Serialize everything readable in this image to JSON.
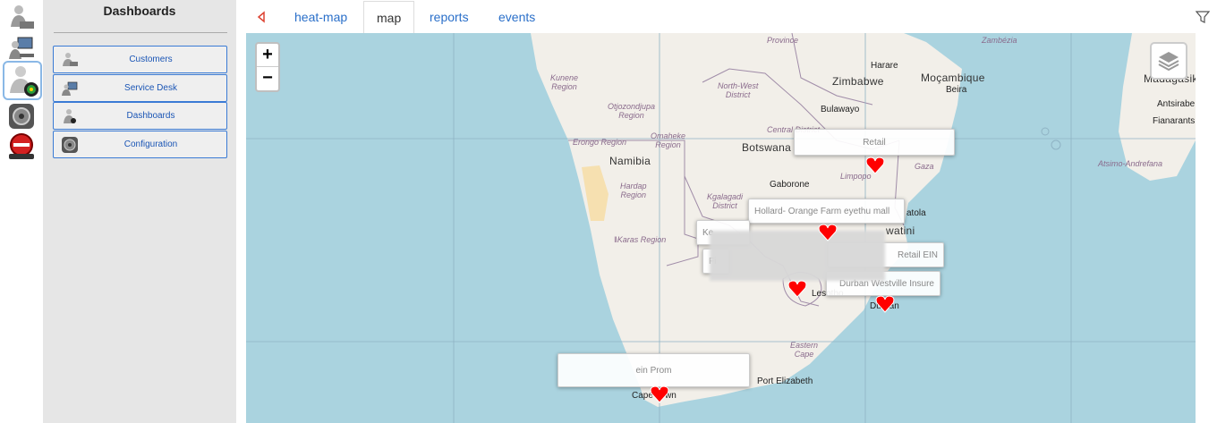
{
  "rail": {
    "items": [
      {
        "icon": "user-desk-icon"
      },
      {
        "icon": "service-desk-icon"
      },
      {
        "icon": "dashboards-icon",
        "selected": true
      },
      {
        "icon": "configuration-gear-icon"
      },
      {
        "icon": "logout-icon",
        "label": "LOGOUT"
      }
    ]
  },
  "panel": {
    "title": "Dashboards",
    "items": [
      {
        "label": "Customers",
        "icon": "customers-icon"
      },
      {
        "label": "Service Desk",
        "icon": "service-desk-icon"
      },
      {
        "label": "Dashboards",
        "icon": "dashboards-icon"
      },
      {
        "label": "Configuration",
        "icon": "configuration-icon"
      }
    ]
  },
  "tabs": {
    "items": [
      "heat-map",
      "map",
      "reports",
      "events"
    ],
    "active": "map"
  },
  "map": {
    "zoom_in": "+",
    "zoom_out": "−",
    "labels": {
      "province_top": "Province",
      "zambezia": "Zambézia",
      "harare": "Harare",
      "zimbabwe": "Zimbabwe",
      "mocambique": "Moçambique",
      "beira": "Beira",
      "madagasikara": "Madagasikara",
      "antsirabe": "Antsirabe",
      "fianarantsoa": "Fianarants",
      "atsimo": "Atsimo-Andrefana",
      "kunene": "Kunene\nRegion",
      "north_west": "North-West\nDistrict",
      "bulawayo": "Bulawayo",
      "otjozondjupa": "Otjozondjupa\nRegion",
      "omaheke": "Omaheke\nRegion",
      "central": "Central District",
      "erongo": "Erongo Region",
      "namibia": "Namibia",
      "botswana": "Botswana",
      "limpopo": "Limpopo",
      "gaza": "Gaza",
      "hardap": "Hardap\nRegion",
      "gaborone": "Gaborone",
      "kgalagadi": "Kgalagadi\nDistrict",
      "karas": "ǁKaras Region",
      "matola": "atola",
      "eswatini": "watini",
      "lesotho": "Lesotho",
      "durban": "Durban",
      "eastern_cape": "Eastern\nCape",
      "port_elizabeth": "Port Elizabeth",
      "cape_town": "Cape Town"
    },
    "popups": [
      {
        "text": "Retail"
      },
      {
        "text": "Hollard- Orange Farm eyethu mall"
      },
      {
        "text": "Ke"
      },
      {
        "text": "Retail EIN"
      },
      {
        "text": "Durban Westville Insure"
      },
      {
        "text": "ein Prom"
      },
      {
        "text": "Fi"
      }
    ]
  },
  "colors": {
    "water": "#aad3df",
    "land": "#f2efe9",
    "marker": "#ff0000",
    "accent": "#3a7bd5"
  }
}
